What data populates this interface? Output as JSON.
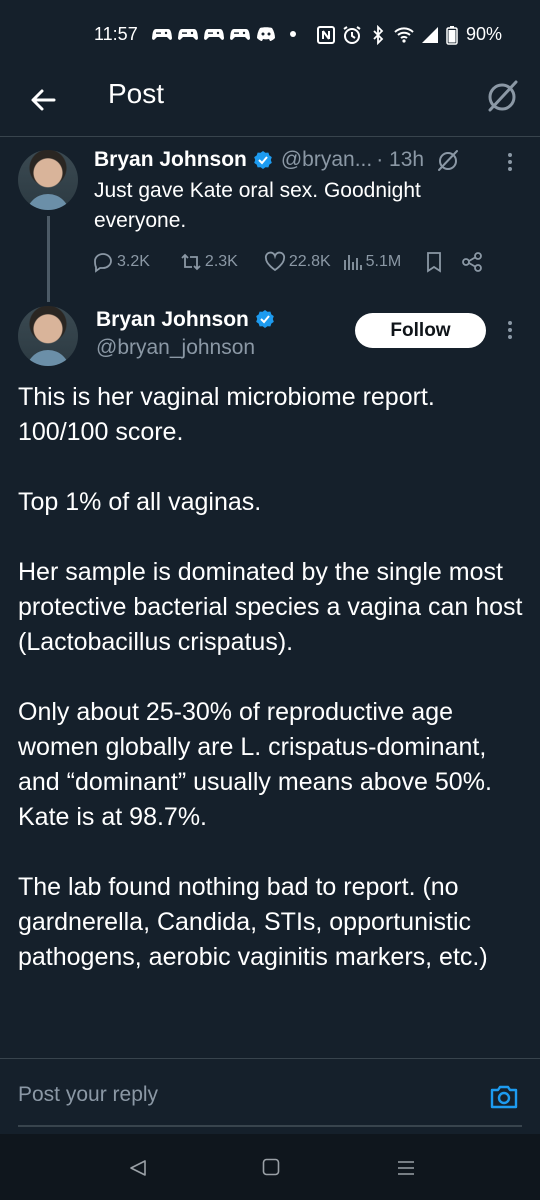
{
  "status_bar": {
    "time": "11:57",
    "battery": "90%",
    "notification_icons": [
      "game-controller-icon",
      "game-controller-icon",
      "game-controller-icon",
      "game-controller-icon",
      "discord-icon"
    ],
    "system_icons": [
      "nfc-icon",
      "alarm-icon",
      "bluetooth-icon",
      "wifi-icon",
      "signal-icon",
      "battery-icon"
    ]
  },
  "header": {
    "title": "Post",
    "back_icon": "arrow-left-icon",
    "grok_icon": "grok-icon"
  },
  "parent_tweet": {
    "author": "Bryan Johnson",
    "handle": "@bryan...",
    "time": "· 13h",
    "text": "Just gave Kate oral sex. Goodnight everyone.",
    "replies": "3.2K",
    "reposts": "2.3K",
    "likes": "22.8K",
    "views": "5.1M"
  },
  "main_tweet": {
    "author": "Bryan Johnson",
    "handle": "@bryan_johnson",
    "follow_label": "Follow",
    "paragraphs": [
      "This is her vaginal microbiome report. 100/100 score.",
      "Top 1% of all vaginas.",
      "Her sample is dominated by the single most protective bacterial species a vagina can host (Lactobacillus crispatus).",
      "Only about 25-30% of reproductive age women globally are L. crispatus-dominant, and “dominant” usually means above 50%. Kate is at 98.7%.",
      "The lab found nothing bad to report. (no gardnerella, Candida, STIs, opportunistic pathogens, aerobic vaginitis markers, etc.)"
    ]
  },
  "reply_bar": {
    "placeholder": "Post your reply"
  },
  "colors": {
    "background": "#15202b",
    "verified": "#1d9bf0",
    "muted": "#8b98a5",
    "divider": "#38444d"
  }
}
